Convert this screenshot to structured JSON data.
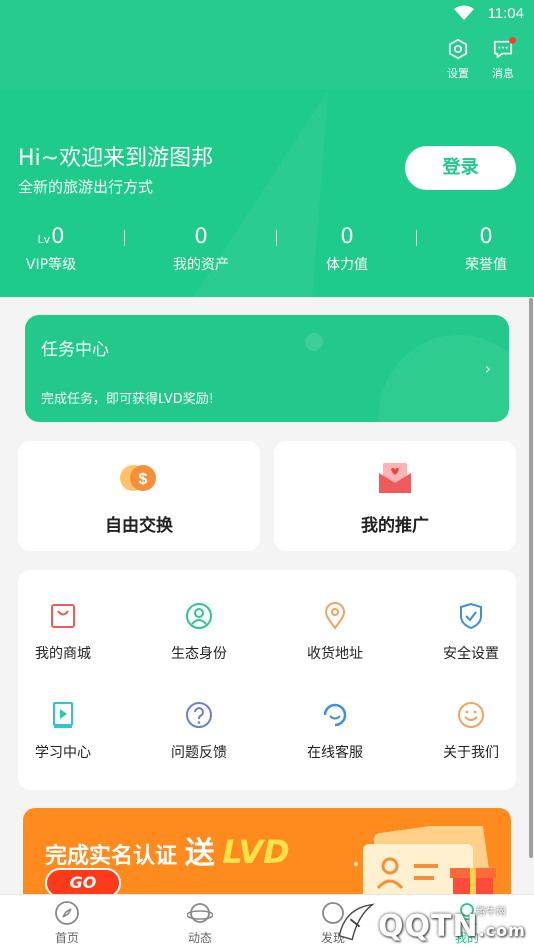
{
  "status_bar": {
    "time": "11:04"
  },
  "top_actions": {
    "settings_label": "设置",
    "messages_label": "消息"
  },
  "profile": {
    "greeting": "Hi~欢迎来到游图邦",
    "slogan": "全新的旅游出行方式",
    "login_label": "登录"
  },
  "stats": [
    {
      "prefix": "Lv",
      "value": "0",
      "label": "VIP等级"
    },
    {
      "prefix": "",
      "value": "0",
      "label": "我的资产"
    },
    {
      "prefix": "",
      "value": "0",
      "label": "体力值"
    },
    {
      "prefix": "",
      "value": "0",
      "label": "荣誉值"
    }
  ],
  "task_center": {
    "title": "任务中心",
    "subtitle": "完成任务，即可获得LVD奖励!",
    "arrow": "›"
  },
  "quick_cards": [
    {
      "label": "自由交换",
      "icon": "coin-exchange-icon"
    },
    {
      "label": "我的推广",
      "icon": "promotion-envelope-icon"
    }
  ],
  "services": [
    {
      "label": "我的商城",
      "icon": "shopping-bag-icon",
      "color": "#f05a5a"
    },
    {
      "label": "生态身份",
      "icon": "user-identity-icon",
      "color": "#2ec68e"
    },
    {
      "label": "收货地址",
      "icon": "location-pin-icon",
      "color": "#f4a261"
    },
    {
      "label": "安全设置",
      "icon": "shield-check-icon",
      "color": "#3a8ee6"
    },
    {
      "label": "学习中心",
      "icon": "video-book-icon",
      "color": "#2ec6c6"
    },
    {
      "label": "问题反馈",
      "icon": "question-icon",
      "color": "#6b7fd7"
    },
    {
      "label": "在线客服",
      "icon": "customer-service-icon",
      "color": "#3a8ee6"
    },
    {
      "label": "关于我们",
      "icon": "smile-icon",
      "color": "#f4a261"
    }
  ],
  "banner": {
    "text_prefix": "完成实名认证",
    "text_big": "送",
    "text_lvd": "LVD",
    "go_label": "GO"
  },
  "tabbar": [
    {
      "label": "首页",
      "icon": "compass-icon"
    },
    {
      "label": "动态",
      "icon": "planet-icon"
    },
    {
      "label": "发现",
      "icon": "discover-icon"
    },
    {
      "label": "我的",
      "icon": "profile-icon"
    }
  ],
  "watermark": {
    "logo": "QQTN",
    "sub": "腾牛网",
    "domain": ".com"
  },
  "colors": {
    "brand_green": "#1fcb8a",
    "banner_orange": "#ff8a1e",
    "badge_red": "#ff3b30"
  }
}
